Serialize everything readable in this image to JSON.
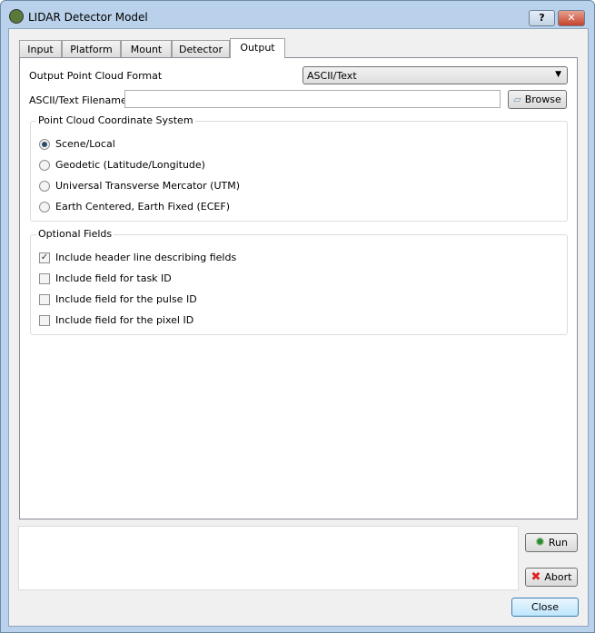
{
  "window": {
    "title": "LIDAR Detector Model",
    "help": "?",
    "close": "✕"
  },
  "tabs": [
    {
      "label": "Input"
    },
    {
      "label": "Platform"
    },
    {
      "label": "Mount"
    },
    {
      "label": "Detector"
    },
    {
      "label": "Output",
      "active": true
    }
  ],
  "output": {
    "format_label": "Output Point Cloud Format",
    "format_value": "ASCII/Text",
    "filename_label": "ASCII/Text Filename",
    "filename_value": "",
    "browse": "Browse",
    "coord_group": "Point Cloud Coordinate System",
    "coords": [
      {
        "label": "Scene/Local",
        "selected": true
      },
      {
        "label": "Geodetic (Latitude/Longitude)"
      },
      {
        "label": "Universal Transverse Mercator (UTM)"
      },
      {
        "label": "Earth Centered, Earth Fixed (ECEF)"
      }
    ],
    "fields_group": "Optional Fields",
    "fields": [
      {
        "label": "Include header line describing fields",
        "checked": true
      },
      {
        "label": "Include field for task ID"
      },
      {
        "label": "Include field for the pulse ID"
      },
      {
        "label": "Include field for the pixel ID"
      }
    ]
  },
  "buttons": {
    "run": "Run",
    "abort": "Abort",
    "close": "Close"
  },
  "colors": {
    "run_icon": "#2e8b2e",
    "abort_icon": "#e02020"
  }
}
